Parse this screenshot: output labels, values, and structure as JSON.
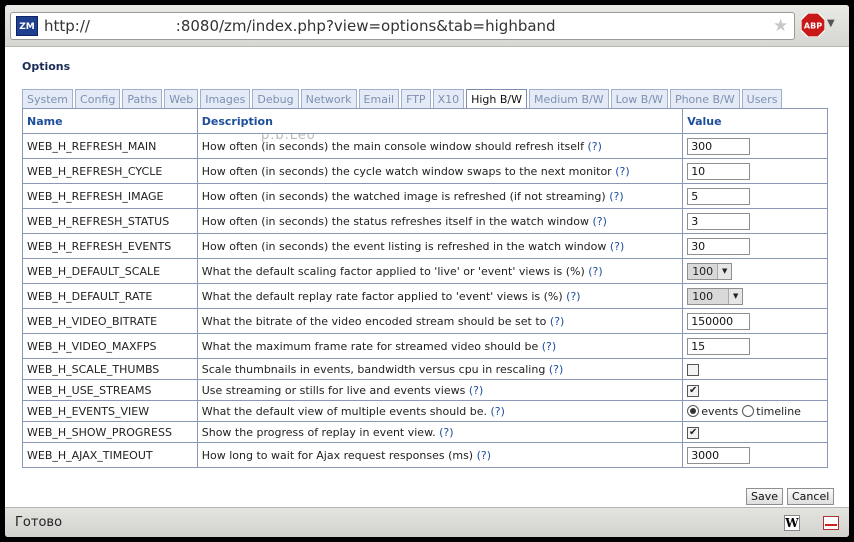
{
  "browser": {
    "url": "http://                  :8080/zm/index.php?view=options&tab=highband",
    "status": "Готово",
    "logo": "ZM",
    "abp": "ABP",
    "w_icon": "W"
  },
  "page": {
    "title": "Options",
    "watermark": "p.b.Leo",
    "tabs": [
      "System",
      "Config",
      "Paths",
      "Web",
      "Images",
      "Debug",
      "Network",
      "Email",
      "FTP",
      "X10",
      "High B/W",
      "Medium B/W",
      "Low B/W",
      "Phone B/W",
      "Users"
    ],
    "active_tab": "High B/W",
    "headers": {
      "name": "Name",
      "description": "Description",
      "value": "Value"
    },
    "rows": [
      {
        "name": "WEB_H_REFRESH_MAIN",
        "desc": "How often (in seconds) the main console window should refresh itself",
        "value": "300"
      },
      {
        "name": "WEB_H_REFRESH_CYCLE",
        "desc": "How often (in seconds) the cycle watch window swaps to the next monitor",
        "value": "10"
      },
      {
        "name": "WEB_H_REFRESH_IMAGE",
        "desc": "How often (in seconds) the watched image is refreshed (if not streaming)",
        "value": "5"
      },
      {
        "name": "WEB_H_REFRESH_STATUS",
        "desc": "How often (in seconds) the status refreshes itself in the watch window",
        "value": "3"
      },
      {
        "name": "WEB_H_REFRESH_EVENTS",
        "desc": "How often (in seconds) the event listing is refreshed in the watch window",
        "value": "30"
      },
      {
        "name": "WEB_H_DEFAULT_SCALE",
        "desc": "What the default scaling factor applied to 'live' or 'event' views is (%)",
        "value": "100"
      },
      {
        "name": "WEB_H_DEFAULT_RATE",
        "desc": "What the default replay rate factor applied to 'event' views is (%)",
        "value": "100"
      },
      {
        "name": "WEB_H_VIDEO_BITRATE",
        "desc": "What the bitrate of the video encoded stream should be set to",
        "value": "150000"
      },
      {
        "name": "WEB_H_VIDEO_MAXFPS",
        "desc": "What the maximum frame rate for streamed video should be",
        "value": "15"
      },
      {
        "name": "WEB_H_SCALE_THUMBS",
        "desc": "Scale thumbnails in events, bandwidth versus cpu in rescaling",
        "checked": false
      },
      {
        "name": "WEB_H_USE_STREAMS",
        "desc": "Use streaming or stills for live and events views",
        "checked": true
      },
      {
        "name": "WEB_H_EVENTS_VIEW",
        "desc": "What the default view of multiple events should be.",
        "options": [
          "events",
          "timeline"
        ],
        "selected": "events"
      },
      {
        "name": "WEB_H_SHOW_PROGRESS",
        "desc": "Show the progress of replay in event view.",
        "checked": true
      },
      {
        "name": "WEB_H_AJAX_TIMEOUT",
        "desc": "How long to wait for Ajax request responses (ms)",
        "value": "3000"
      }
    ],
    "help_mark": "(?)",
    "save_label": "Save",
    "cancel_label": "Cancel"
  }
}
